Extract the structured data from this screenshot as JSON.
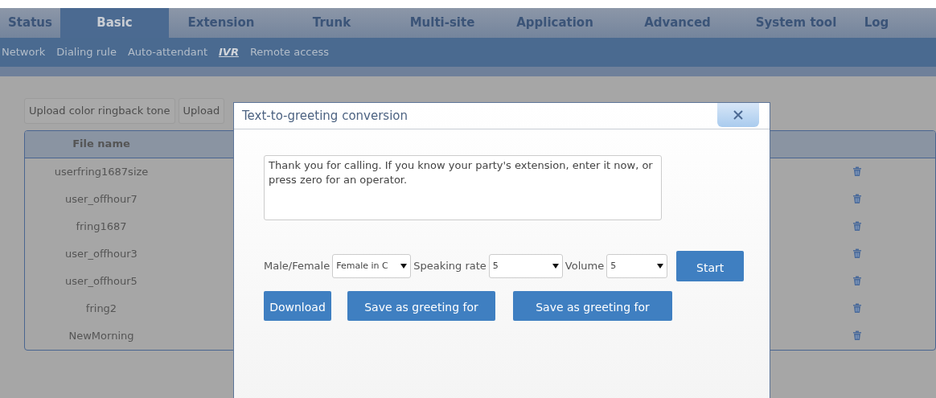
{
  "tabs": [
    {
      "label": "Status",
      "selected": false
    },
    {
      "label": "Basic",
      "selected": true
    },
    {
      "label": "Extension",
      "selected": false
    },
    {
      "label": "Trunk",
      "selected": false
    },
    {
      "label": "Multi-site",
      "selected": false
    },
    {
      "label": "Application",
      "selected": false
    },
    {
      "label": "Advanced",
      "selected": false
    },
    {
      "label": "System tool",
      "selected": false
    },
    {
      "label": "Log",
      "selected": false
    }
  ],
  "subnav": [
    {
      "label": "Network",
      "selected": false
    },
    {
      "label": "Dialing rule",
      "selected": false
    },
    {
      "label": "Auto-attendant",
      "selected": false
    },
    {
      "label": "IVR",
      "selected": true
    },
    {
      "label": "Remote access",
      "selected": false
    }
  ],
  "page_buttons": [
    "Upload color ringback tone",
    "Upload"
  ],
  "table": {
    "columns": [
      "File name"
    ],
    "rows": [
      {
        "file_name": "userfring1687size"
      },
      {
        "file_name": "user_offhour7"
      },
      {
        "file_name": "fring1687"
      },
      {
        "file_name": "user_offhour3"
      },
      {
        "file_name": "user_offhour5"
      },
      {
        "file_name": "fring2"
      },
      {
        "file_name": "NewMorning"
      }
    ]
  },
  "dialog": {
    "title": "Text-to-greeting conversion",
    "text": "Thank you for calling. If you know your party's extension, enter it now, or press zero for an operator.",
    "selects": [
      {
        "label": "Male/Female",
        "value": "Female in C"
      },
      {
        "label": "Speaking rate",
        "value": "5"
      },
      {
        "label": "Volume",
        "value": "5"
      }
    ],
    "start_button": "Start",
    "action_buttons": [
      "Download",
      "Save as greeting for",
      "Save as greeting for"
    ]
  }
}
